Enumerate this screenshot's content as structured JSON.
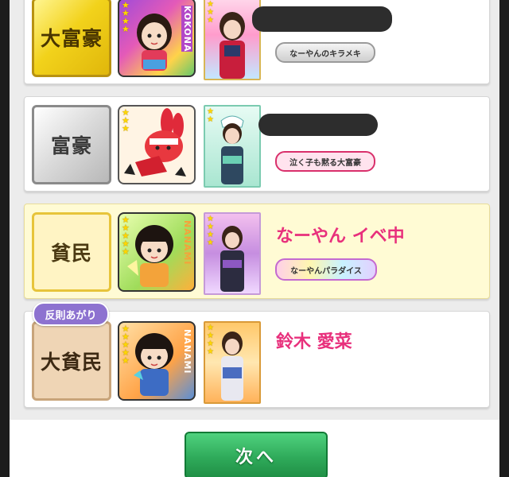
{
  "colors": {
    "accent": "#e8307c",
    "next_button": "#2faa5a"
  },
  "rows": [
    {
      "rank": "大富豪",
      "avatar_label": "KOKONA",
      "name": "",
      "name_redacted": true,
      "title": "なーやんのキラメキ",
      "highlight": false
    },
    {
      "rank": "富豪",
      "avatar_label": "",
      "name": "",
      "name_redacted": true,
      "title": "泣く子も黙る大富豪",
      "highlight": false
    },
    {
      "rank": "貧民",
      "avatar_label": "NANAMI",
      "name": "なーやん イベ中",
      "name_redacted": false,
      "title": "なーやんパラダイス",
      "highlight": true
    },
    {
      "rank": "大貧民",
      "rank_badge": "反則あがり",
      "avatar_label": "NANAMI",
      "name": "鈴木 愛菜",
      "name_redacted": false,
      "title": "",
      "highlight": false
    }
  ],
  "next_button": {
    "label": "次へ"
  }
}
